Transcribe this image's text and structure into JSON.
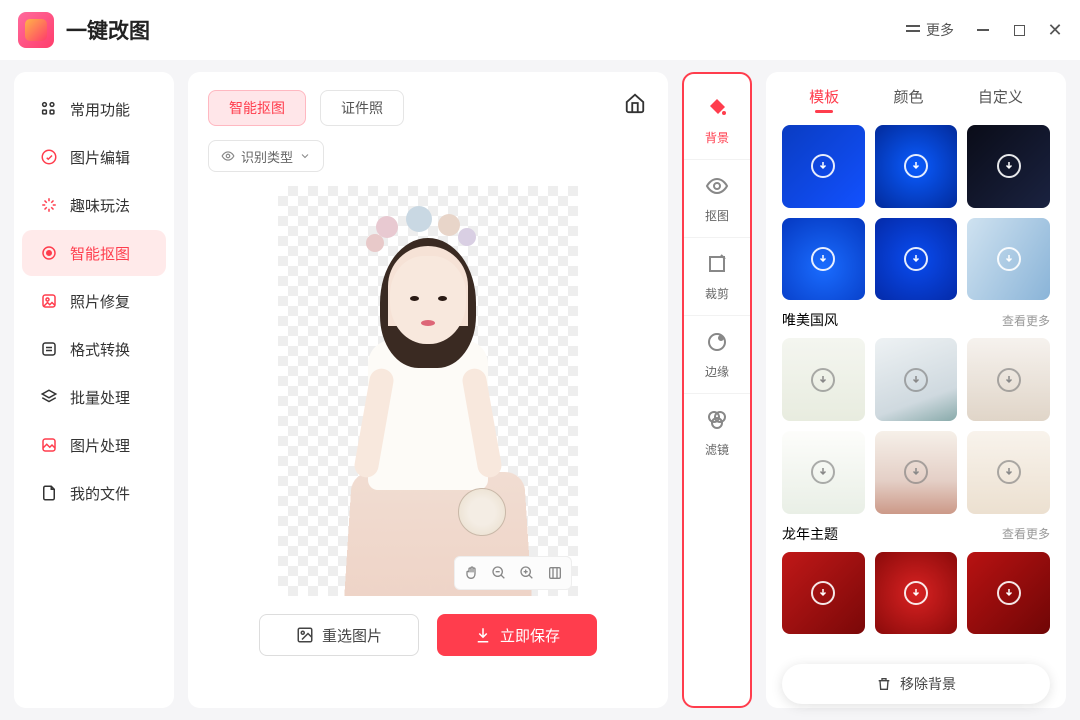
{
  "app": {
    "title": "一键改图",
    "more_label": "更多"
  },
  "sidebar": {
    "items": [
      {
        "label": "常用功能"
      },
      {
        "label": "图片编辑"
      },
      {
        "label": "趣味玩法"
      },
      {
        "label": "智能抠图"
      },
      {
        "label": "照片修复"
      },
      {
        "label": "格式转换"
      },
      {
        "label": "批量处理"
      },
      {
        "label": "图片处理"
      },
      {
        "label": "我的文件"
      }
    ],
    "active_index": 3
  },
  "main": {
    "tabs": [
      {
        "label": "智能抠图",
        "active": true
      },
      {
        "label": "证件照",
        "active": false
      }
    ],
    "dropdown_label": "识别类型",
    "reselect_label": "重选图片",
    "save_label": "立即保存"
  },
  "midtools": {
    "items": [
      {
        "label": "背景"
      },
      {
        "label": "抠图"
      },
      {
        "label": "裁剪"
      },
      {
        "label": "边缘"
      },
      {
        "label": "滤镜"
      }
    ],
    "active_index": 0
  },
  "right": {
    "tabs": [
      {
        "label": "模板"
      },
      {
        "label": "颜色"
      },
      {
        "label": "自定义"
      }
    ],
    "active_index": 0,
    "section1": {
      "title": "唯美国风",
      "more": "查看更多"
    },
    "section2": {
      "title": "龙年主题",
      "more": "查看更多"
    },
    "remove_bg_label": "移除背景"
  },
  "colors": {
    "accent": "#ff3d4d",
    "templates_row1": [
      "linear-gradient(135deg,#0a3cc2,#1251ff)",
      "radial-gradient(circle,#0a5cff,#022a9a)",
      "linear-gradient(135deg,#0a0c18,#1a2240)"
    ],
    "templates_row2": [
      "radial-gradient(circle at 50% 60%,#1a6cff,#0538c0)",
      "radial-gradient(circle,#0a4cf0,#042aa8)",
      "linear-gradient(120deg,#cfe2f0,#8ab4d8)"
    ],
    "guofeng": [
      "linear-gradient(#f4f6f0,#e8ecdf)",
      "linear-gradient(160deg,#eef2f4,#cfd9df 70%,#8aa 100%)",
      "linear-gradient(#f6f2ee,#e0d5c8)",
      "linear-gradient(#fdfdfb,#e9efe6)",
      "linear-gradient(180deg,#f6f0e9,#e4cfc6 60%,#c98 100%)",
      "linear-gradient(#f8f3ec,#ece0d0)"
    ],
    "dragon": [
      "linear-gradient(135deg,#c01818,#7a0808)",
      "radial-gradient(circle,#d82222,#8a0a0a)",
      "linear-gradient(135deg,#b81212,#700606)"
    ]
  }
}
